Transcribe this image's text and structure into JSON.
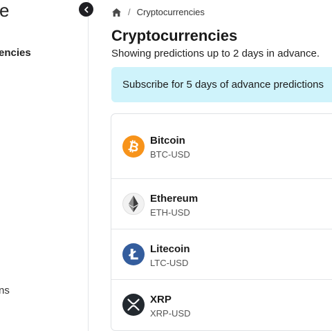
{
  "sidebar": {
    "brand_fragment": "e",
    "active_item_fragment": "encies",
    "bottom_item_fragment": "ns"
  },
  "breadcrumb": {
    "separator": "/",
    "current": "Cryptocurrencies"
  },
  "page": {
    "title": "Cryptocurrencies",
    "subtitle": "Showing predictions up to 2 days in advance."
  },
  "banner": {
    "text": "Subscribe for 5 days of advance predictions"
  },
  "coins": [
    {
      "name": "Bitcoin",
      "ticker": "BTC-USD",
      "icon": "bitcoin-icon",
      "color": "#f7931a"
    },
    {
      "name": "Ethereum",
      "ticker": "ETH-USD",
      "icon": "ethereum-icon",
      "color": "#3c3c3d"
    },
    {
      "name": "Litecoin",
      "ticker": "LTC-USD",
      "icon": "litecoin-icon",
      "color": "#345d9d"
    },
    {
      "name": "XRP",
      "ticker": "XRP-USD",
      "icon": "xrp-icon",
      "color": "#23292f"
    }
  ],
  "colors": {
    "banner_bg": "#cff3fb",
    "sidebar_toggle": "#1f1f23",
    "border": "#e3e5e8"
  }
}
